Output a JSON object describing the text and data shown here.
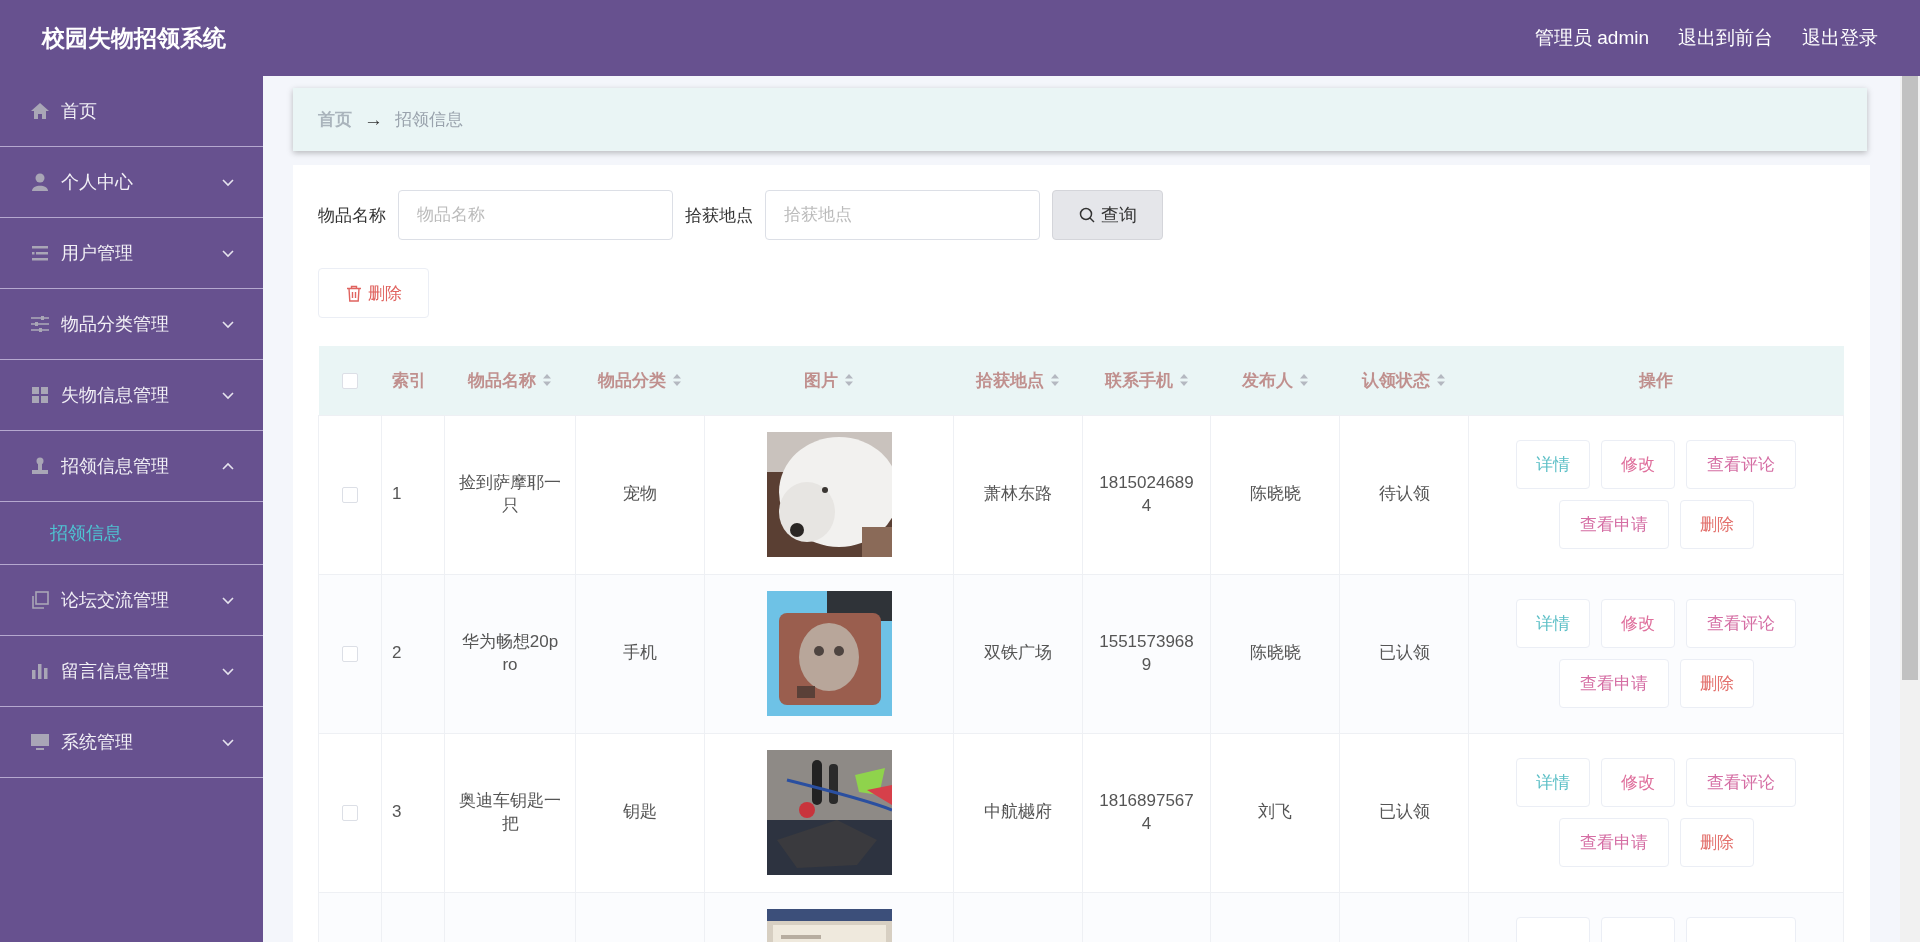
{
  "header": {
    "title": "校园失物招领系统",
    "user": "管理员 admin",
    "links": [
      "退出到前台",
      "退出登录"
    ]
  },
  "sidebar": {
    "items": [
      {
        "kind": "home",
        "label": "首页",
        "expandable": false
      },
      {
        "kind": "person",
        "label": "个人中心",
        "expandable": true,
        "expanded": false
      },
      {
        "kind": "list",
        "label": "用户管理",
        "expandable": true,
        "expanded": false
      },
      {
        "kind": "sliders",
        "label": "物品分类管理",
        "expandable": true,
        "expanded": false
      },
      {
        "kind": "grid",
        "label": "失物信息管理",
        "expandable": true,
        "expanded": false
      },
      {
        "kind": "stamp",
        "label": "招领信息管理",
        "expandable": true,
        "expanded": true,
        "children": [
          {
            "label": "招领信息",
            "selected": true
          }
        ]
      },
      {
        "kind": "copy",
        "label": "论坛交流管理",
        "expandable": true,
        "expanded": false
      },
      {
        "kind": "chart",
        "label": "留言信息管理",
        "expandable": true,
        "expanded": false
      },
      {
        "kind": "monitor",
        "label": "系统管理",
        "expandable": true,
        "expanded": false
      }
    ]
  },
  "breadcrumb": {
    "items": [
      "首页",
      "招领信息"
    ],
    "separator": "→"
  },
  "search": {
    "fields": [
      {
        "label": "物品名称",
        "placeholder": "物品名称"
      },
      {
        "label": "拾获地点",
        "placeholder": "拾获地点"
      }
    ],
    "button": "查询"
  },
  "toolbar": {
    "delete_button": "删除"
  },
  "table": {
    "select_all": {
      "checked": false
    },
    "columns": [
      {
        "label": "索引",
        "sortable": false
      },
      {
        "label": "物品名称",
        "sortable": true
      },
      {
        "label": "物品分类",
        "sortable": true
      },
      {
        "label": "图片",
        "sortable": true
      },
      {
        "label": "拾获地点",
        "sortable": true
      },
      {
        "label": "联系手机",
        "sortable": true
      },
      {
        "label": "发布人",
        "sortable": true
      },
      {
        "label": "认领状态",
        "sortable": true
      },
      {
        "label": "操作",
        "sortable": false
      }
    ],
    "rows": [
      {
        "checked": false,
        "index": "1",
        "name": "捡到萨摩耶一只",
        "category": "宠物",
        "picture": {
          "kind": "picture"
        },
        "location": "萧林东路",
        "phone": "18150246894",
        "publisher": "陈晓晓",
        "status": "待认领",
        "actions": [
          {
            "kind": "detail",
            "label": "详情"
          },
          {
            "kind": "edit",
            "label": "修改"
          },
          {
            "kind": "comments",
            "label": "查看评论"
          },
          {
            "kind": "applications",
            "label": "查看申请"
          },
          {
            "kind": "delete",
            "label": "删除"
          }
        ]
      },
      {
        "checked": false,
        "index": "2",
        "name": "华为畅想20pro",
        "category": "手机",
        "picture": {
          "kind": "picture"
        },
        "location": "双铁广场",
        "phone": "15515739689",
        "publisher": "陈晓晓",
        "status": "已认领",
        "actions": [
          {
            "kind": "detail",
            "label": "详情"
          },
          {
            "kind": "edit",
            "label": "修改"
          },
          {
            "kind": "comments",
            "label": "查看评论"
          },
          {
            "kind": "applications",
            "label": "查看申请"
          },
          {
            "kind": "delete",
            "label": "删除"
          }
        ]
      },
      {
        "checked": false,
        "index": "3",
        "name": "奥迪车钥匙一把",
        "category": "钥匙",
        "picture": {
          "kind": "picture"
        },
        "location": "中航樾府",
        "phone": "18168975674",
        "publisher": "刘飞",
        "status": "已认领",
        "actions": [
          {
            "kind": "detail",
            "label": "详情"
          },
          {
            "kind": "edit",
            "label": "修改"
          },
          {
            "kind": "comments",
            "label": "查看评论"
          },
          {
            "kind": "applications",
            "label": "查看申请"
          },
          {
            "kind": "delete",
            "label": "删除"
          }
        ]
      },
      {
        "picture": {
          "kind": "picture"
        },
        "actions": [
          {
            "kind": "detail"
          },
          {
            "kind": "edit"
          },
          {
            "kind": "comments"
          }
        ]
      }
    ]
  }
}
